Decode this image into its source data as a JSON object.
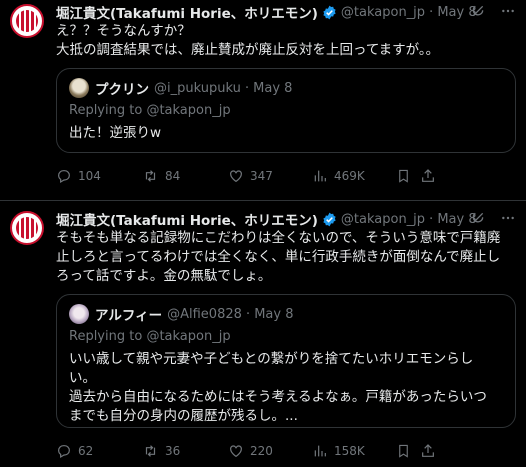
{
  "tweets": [
    {
      "author_name": "堀江貴文(Takafumi Horie、ホリエモン)",
      "author_handle": "@takapon_jp",
      "date": "May 8",
      "text": "え？？そうなんすか？\n大抵の調査結果では、廃止賛成が廃止反対を上回ってますが。。",
      "quote": {
        "author_name": "プクリン",
        "author_handle": "@i_pukupuku",
        "date": "May 8",
        "replying_prefix": "Replying to ",
        "replying_handle": "@takapon_jp",
        "text": "出た！逆張りw"
      },
      "counts": {
        "replies": "104",
        "retweets": "84",
        "likes": "347",
        "views": "469K"
      }
    },
    {
      "author_name": "堀江貴文(Takafumi Horie、ホリエモン)",
      "author_handle": "@takapon_jp",
      "date": "May 8",
      "text": "そもそも単なる記録物にこだわりは全くないので、そういう意味で戸籍廃\n止しろと言ってるわけでは全くなく、単に行政手続きが面倒なんで廃止し\nろって話ですよ。金の無駄でしょ。",
      "quote": {
        "author_name": "アルフィー",
        "author_handle": "@Alfie0828",
        "date": "May 8",
        "replying_prefix": "Replying to ",
        "replying_handle": "@takapon_jp",
        "text": "いい歳して親や元妻や子どもとの繋がりを捨てたいホリエモンらし\nい。\n過去から自由になるためにはそう考えるよなぁ。戸籍があったらいつ\nまでも自分の身内の履歴が残るし。..."
      },
      "counts": {
        "replies": "62",
        "retweets": "36",
        "likes": "220",
        "views": "158K"
      }
    }
  ],
  "icons": [
    "verified-badge-icon",
    "grok-icon",
    "more-icon",
    "reply-icon",
    "retweet-icon",
    "like-icon",
    "views-icon",
    "bookmark-icon",
    "share-icon"
  ],
  "colors": {
    "background": "#000000",
    "text": "#e7e9ea",
    "muted": "#71767b",
    "border": "#2f3336",
    "verified": "#1d9bf0"
  }
}
